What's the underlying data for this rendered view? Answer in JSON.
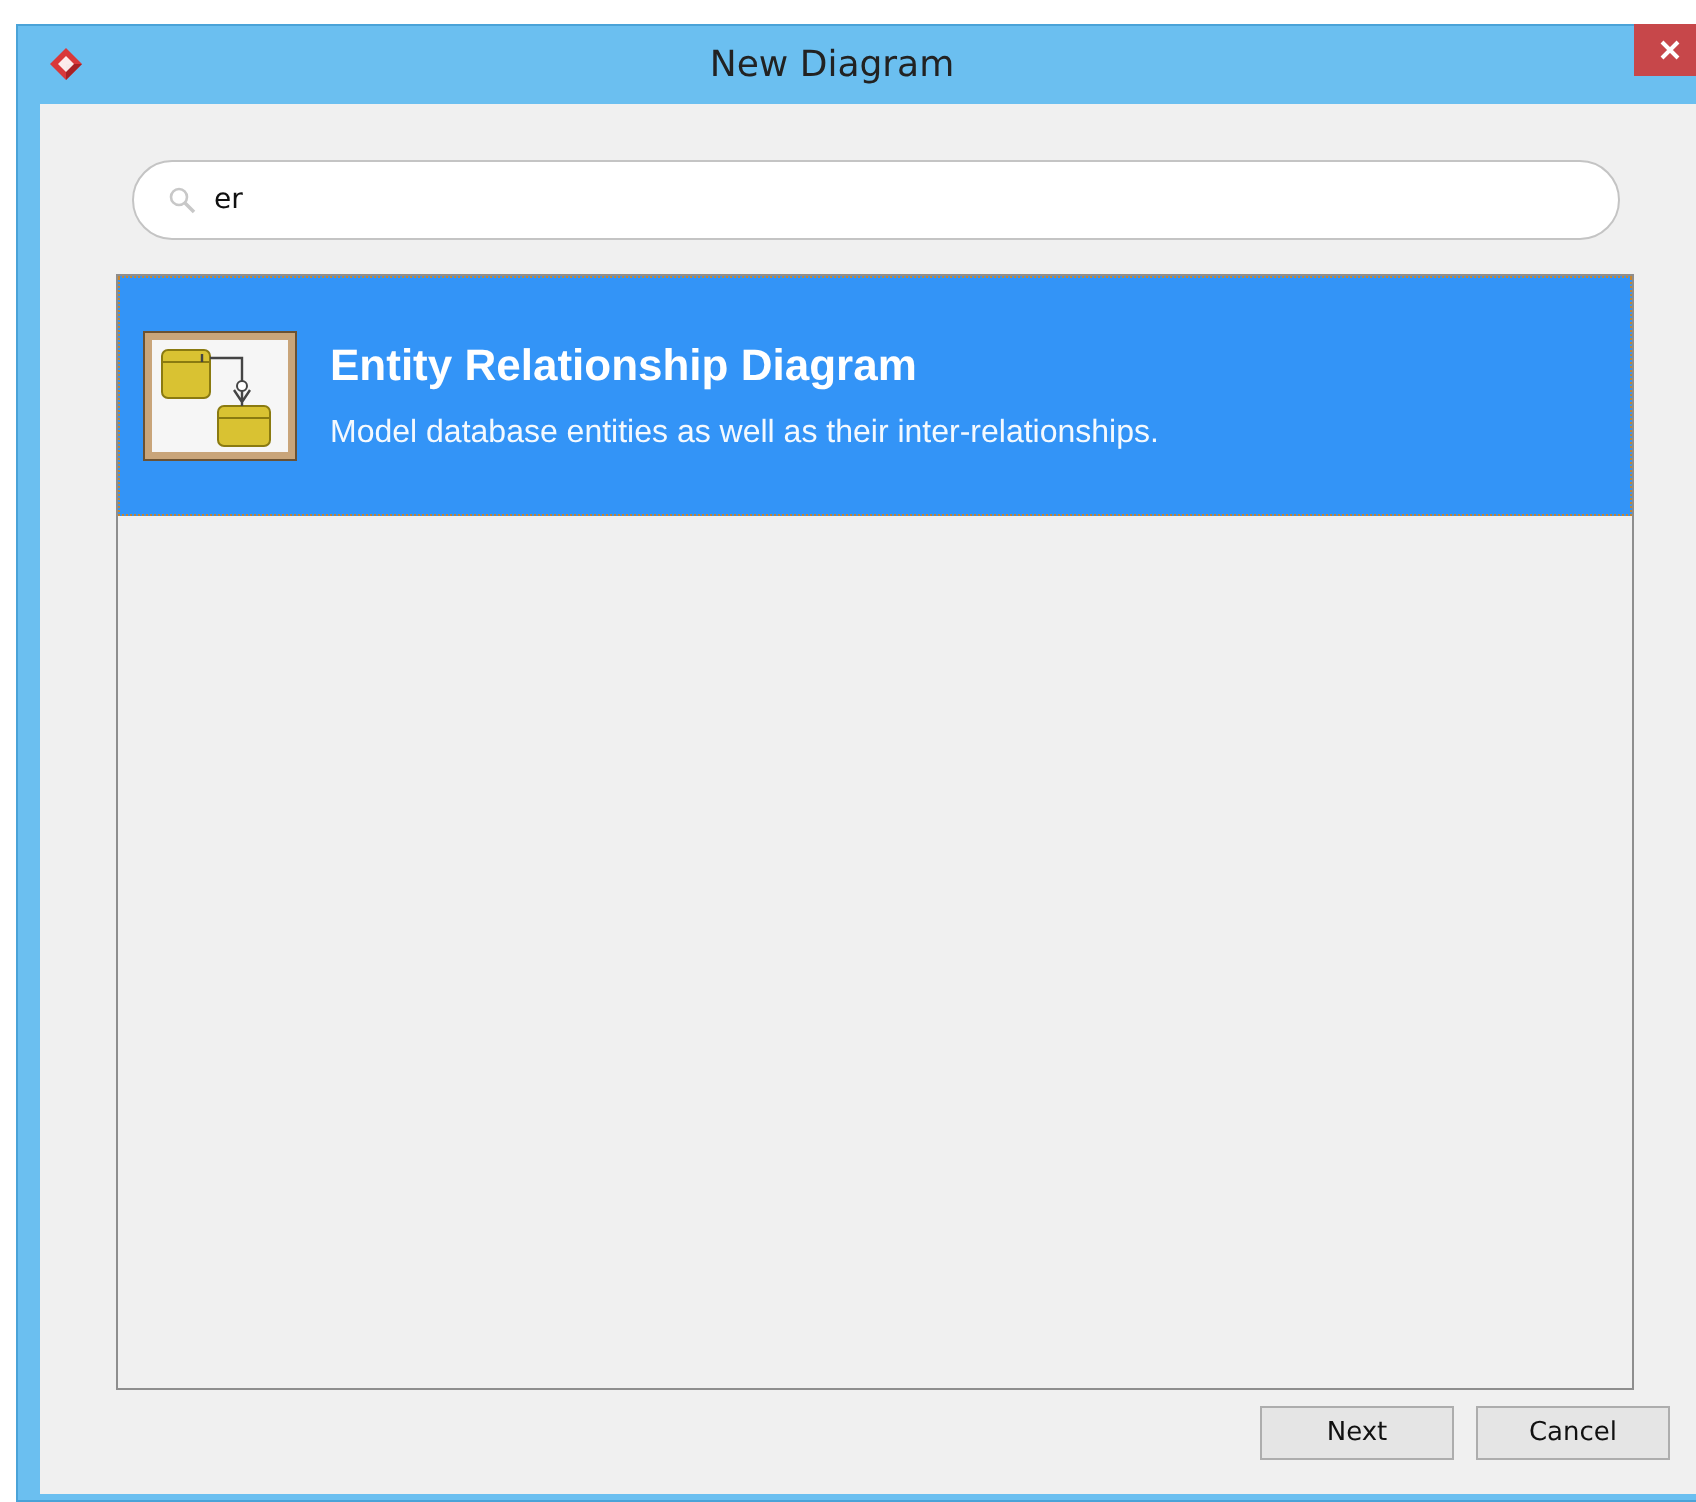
{
  "window": {
    "title": "New Diagram"
  },
  "search": {
    "value": "er"
  },
  "items": [
    {
      "kind": "diagram",
      "title": "Entity Relationship Diagram",
      "description": "Model database entities as well as their inter-relationships.",
      "selected": true
    }
  ],
  "buttons": [
    {
      "label": "Next"
    },
    {
      "label": "Cancel"
    }
  ]
}
